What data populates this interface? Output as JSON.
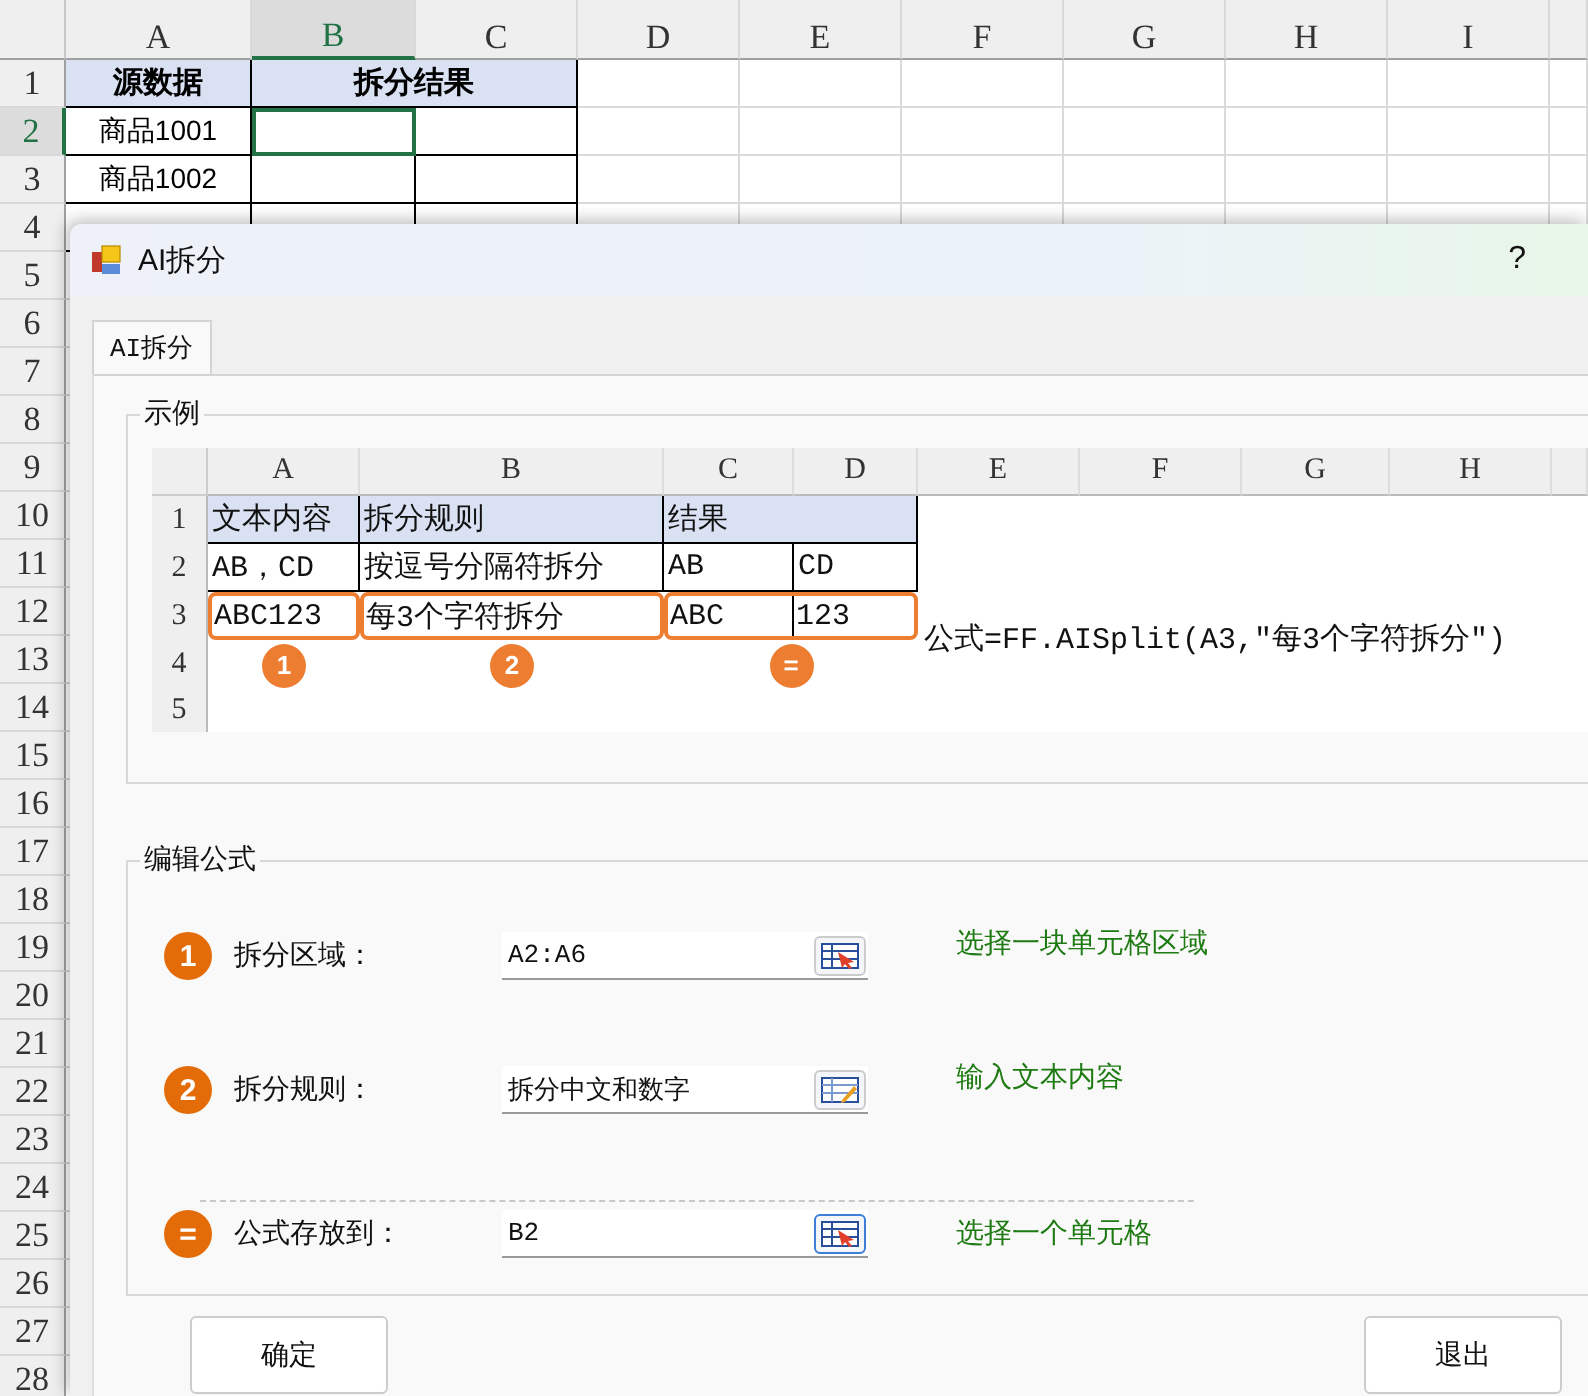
{
  "sheet": {
    "columns": [
      {
        "label": "A",
        "selected": false
      },
      {
        "label": "B",
        "selected": true
      },
      {
        "label": "C",
        "selected": false
      },
      {
        "label": "D",
        "selected": false
      },
      {
        "label": "E",
        "selected": false
      },
      {
        "label": "F",
        "selected": false
      },
      {
        "label": "G",
        "selected": false
      },
      {
        "label": "H",
        "selected": false
      },
      {
        "label": "I",
        "selected": false
      }
    ],
    "row_numbers": [
      {
        "label": "1",
        "selected": false
      },
      {
        "label": "2",
        "selected": true
      },
      {
        "label": "3",
        "selected": false
      },
      {
        "label": "4",
        "selected": false
      },
      {
        "label": "5",
        "selected": false
      },
      {
        "label": "6",
        "selected": false
      },
      {
        "label": "7",
        "selected": false
      },
      {
        "label": "8",
        "selected": false
      },
      {
        "label": "9",
        "selected": false
      },
      {
        "label": "10",
        "selected": false
      },
      {
        "label": "11",
        "selected": false
      },
      {
        "label": "12",
        "selected": false
      },
      {
        "label": "13",
        "selected": false
      },
      {
        "label": "14",
        "selected": false
      },
      {
        "label": "15",
        "selected": false
      },
      {
        "label": "16",
        "selected": false
      },
      {
        "label": "17",
        "selected": false
      },
      {
        "label": "18",
        "selected": false
      },
      {
        "label": "19",
        "selected": false
      },
      {
        "label": "20",
        "selected": false
      },
      {
        "label": "21",
        "selected": false
      },
      {
        "label": "22",
        "selected": false
      },
      {
        "label": "23",
        "selected": false
      },
      {
        "label": "24",
        "selected": false
      },
      {
        "label": "25",
        "selected": false
      },
      {
        "label": "26",
        "selected": false
      },
      {
        "label": "27",
        "selected": false
      },
      {
        "label": "28",
        "selected": false
      }
    ],
    "header": {
      "source": "源数据",
      "result": "拆分结果"
    },
    "data": [
      {
        "source": "商品1001",
        "result_selected": true
      },
      {
        "source": "商品1002",
        "result_selected": false
      }
    ]
  },
  "dialog": {
    "title": "AI拆分",
    "help": "?",
    "tabs": [
      {
        "label": "AI拆分",
        "selected": true
      }
    ],
    "example": {
      "title": "示例",
      "columns": [
        "A",
        "B",
        "C",
        "D",
        "E",
        "F",
        "G",
        "H"
      ],
      "row_numbers": [
        "1",
        "2",
        "3",
        "4",
        "5"
      ],
      "header": [
        "文本内容",
        "拆分规则",
        "结果"
      ],
      "rows": [
        [
          "AB，CD",
          "按逗号分隔符拆分",
          "AB",
          "CD"
        ],
        [
          "ABC123",
          "每3个字符拆分",
          "ABC",
          "123"
        ]
      ],
      "markers": [
        "1",
        "2",
        "="
      ],
      "formula": "公式=FF.AISplit(A3,\"每3个字符拆分\")"
    },
    "edit": {
      "title": "编辑公式",
      "fields": [
        {
          "marker": "1",
          "label": "拆分区域：",
          "value": "A2:A6",
          "kind": "range",
          "focused": false,
          "hint": "选择一块单元格区域"
        },
        {
          "marker": "2",
          "label": "拆分规则：",
          "value": "拆分中文和数字",
          "kind": "text",
          "focused": false,
          "hint": "输入文本内容"
        },
        {
          "marker": "=",
          "label": "公式存放到：",
          "value": "B2",
          "kind": "range",
          "focused": true,
          "hint": "选择一个单元格"
        }
      ]
    },
    "buttons": [
      "确定",
      "退出"
    ]
  }
}
